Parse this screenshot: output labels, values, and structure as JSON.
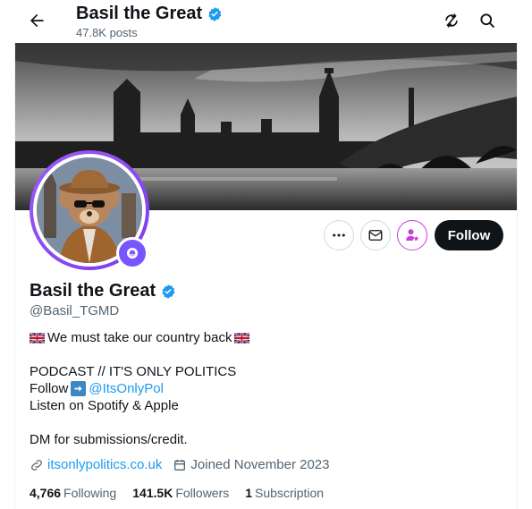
{
  "header": {
    "title": "Basil the Great",
    "posts": "47.8K posts"
  },
  "profile": {
    "name": "Basil the Great",
    "handle": "@Basil_TGMD",
    "follow_label": "Follow"
  },
  "bio": {
    "line1": "We must take our country back",
    "line2": "PODCAST // IT'S ONLY POLITICS",
    "line3_prefix": "Follow",
    "line3_link": "@ItsOnlyPol",
    "line4": "Listen on Spotify & Apple",
    "line5": "DM for submissions/credit."
  },
  "meta": {
    "website": "itsonlypolitics.co.uk",
    "joined": "Joined November 2023"
  },
  "stats": {
    "following_count": "4,766",
    "following_label": "Following",
    "followers_count": "141.5K",
    "followers_label": "Followers",
    "subscription_count": "1",
    "subscription_label": "Subscription"
  },
  "colors": {
    "accent": "#1d9bf0",
    "verified": "#1d9bf0",
    "follow_bg": "#0f1419",
    "subscribe_ring": "#c640d8",
    "avatar_ring": "#7c3aed"
  },
  "icons": [
    "back-arrow-icon",
    "verified-badge-icon",
    "refresh-icon",
    "search-icon",
    "more-icon",
    "message-icon",
    "subscribe-star-icon",
    "link-icon",
    "calendar-icon"
  ]
}
